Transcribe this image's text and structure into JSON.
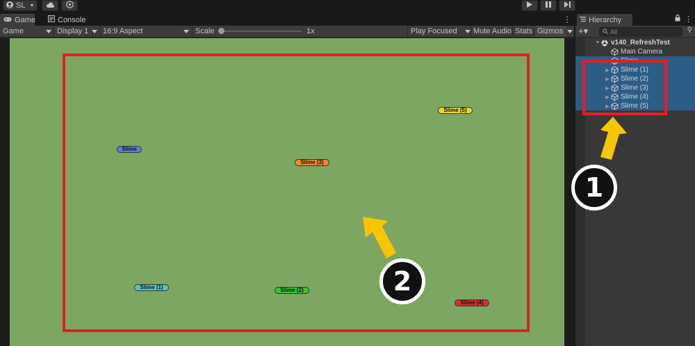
{
  "toolbar": {
    "account_label": "SL",
    "icons": [
      "account-icon",
      "cloud-icon",
      "collab-icon",
      "play-icon",
      "pause-icon",
      "step-icon"
    ]
  },
  "tabs": {
    "game": "Game",
    "console": "Console"
  },
  "game_toolbar": {
    "mode": "Game",
    "display": "Display 1",
    "aspect": "16:9 Aspect",
    "scale_label": "Scale",
    "scale_value": "1x",
    "scale_fraction": 0.02,
    "play_focused": "Play Focused",
    "mute_audio": "Mute Audio",
    "stats": "Stats",
    "gizmos": "Gizmos"
  },
  "viewport": {
    "background": "#7ea663",
    "slimes": [
      {
        "label": "Slime",
        "color": "#4f86d6"
      },
      {
        "label": "Slime (1)",
        "color": "#4fc9c0"
      },
      {
        "label": "Slime (2)",
        "color": "#3cbf3c"
      },
      {
        "label": "Slime (3)",
        "color": "#e98a35"
      },
      {
        "label": "Slime (4)",
        "color": "#d92f2f"
      },
      {
        "label": "Slime (5)",
        "color": "#e8d33a"
      }
    ]
  },
  "hierarchy": {
    "tab_label": "Hierarchy",
    "search_placeholder": "All",
    "scene_name": "v140_RefreshTest",
    "items": [
      {
        "label": "Main Camera",
        "selected": false
      },
      {
        "label": "Slime",
        "selected": true
      },
      {
        "label": "Slime (1)",
        "selected": true
      },
      {
        "label": "Slime (2)",
        "selected": true
      },
      {
        "label": "Slime (3)",
        "selected": true
      },
      {
        "label": "Slime (4)",
        "selected": true
      },
      {
        "label": "Slime (5)",
        "selected": true
      }
    ]
  },
  "annotations": {
    "step_1": "1",
    "step_2": "2",
    "highlight_color": "#e31e24",
    "arrow_color": "#f7c600"
  }
}
